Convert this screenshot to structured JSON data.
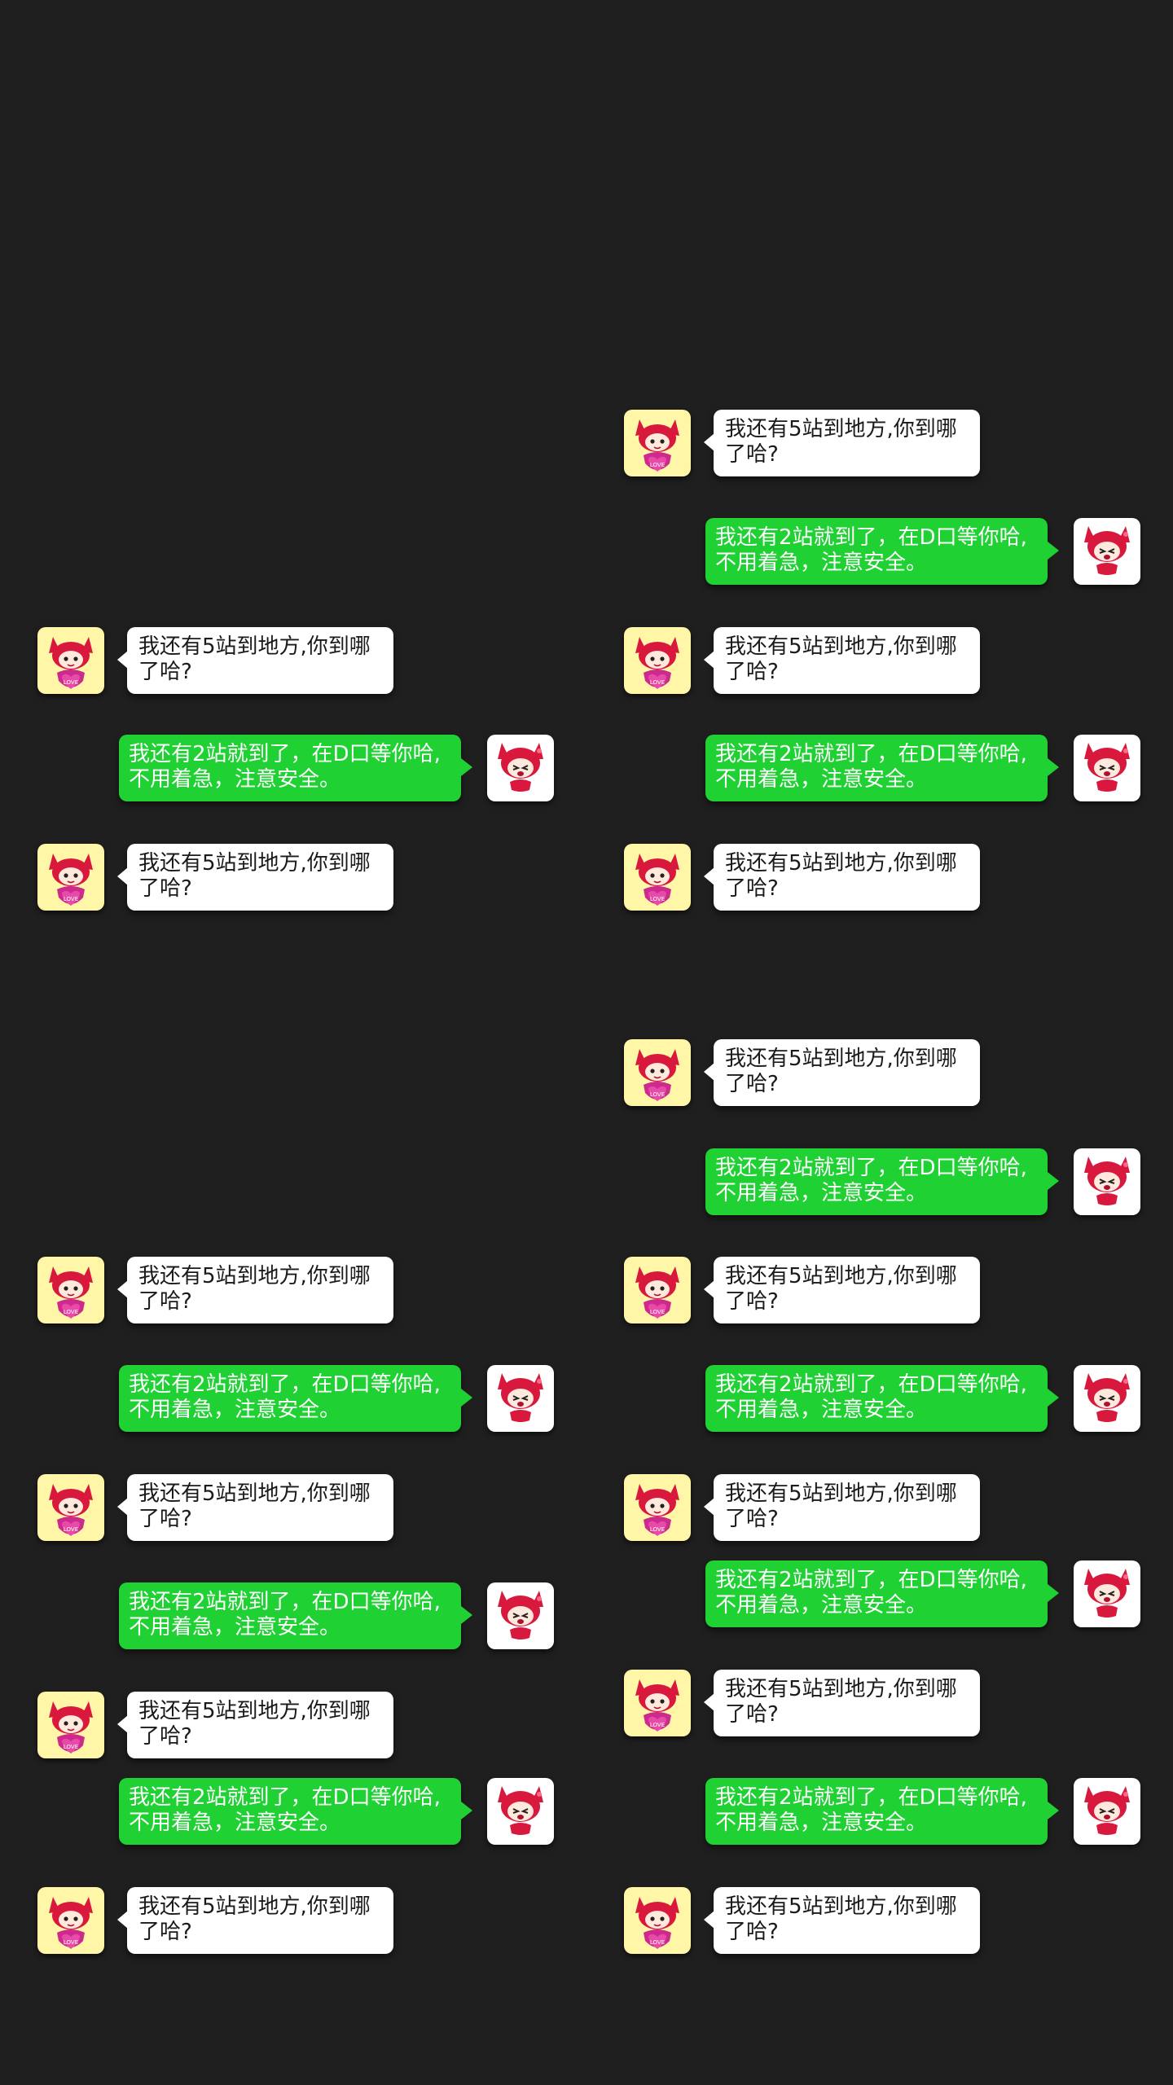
{
  "colors": {
    "background": "#1f1f1f",
    "incoming_bubble": "#ffffff",
    "outgoing_bubble": "#1fd133",
    "incoming_avatar_bg": "#fff6a8",
    "outgoing_avatar_bg": "#ffffff"
  },
  "avatars": {
    "incoming": {
      "icon": "fox-girl-love-heart-avatar-icon",
      "badge_text": "LOVE"
    },
    "outgoing": {
      "icon": "fox-girl-crying-avatar-icon",
      "caption": "给你快乐"
    }
  },
  "messages": {
    "incoming_text": "我还有5站到地方,你到哪\n了哈?",
    "outgoing_text": "我还有2站就到了，在D口等你哈,\n不用着急，注意安全。"
  },
  "conversations": {
    "left_top": [
      {
        "side": "incoming",
        "text": "我还有5站到地方,你到哪\n了哈?"
      },
      {
        "side": "outgoing",
        "text": "我还有2站就到了，在D口等你哈,\n不用着急，注意安全。"
      },
      {
        "side": "incoming",
        "text": "我还有5站到地方,你到哪\n了哈?"
      }
    ],
    "right_top": [
      {
        "side": "incoming",
        "text": "我还有5站到地方,你到哪\n了哈?"
      },
      {
        "side": "outgoing",
        "text": "我还有2站就到了，在D口等你哈,\n不用着急，注意安全。"
      },
      {
        "side": "incoming",
        "text": "我还有5站到地方,你到哪\n了哈?"
      },
      {
        "side": "outgoing",
        "text": "我还有2站就到了，在D口等你哈,\n不用着急，注意安全。"
      },
      {
        "side": "incoming",
        "text": "我还有5站到地方,你到哪\n了哈?"
      }
    ],
    "left_bottom": [
      {
        "side": "incoming",
        "text": "我还有5站到地方,你到哪\n了哈?"
      },
      {
        "side": "outgoing",
        "text": "我还有2站就到了，在D口等你哈,\n不用着急，注意安全。"
      },
      {
        "side": "incoming",
        "text": "我还有5站到地方,你到哪\n了哈?"
      },
      {
        "side": "outgoing",
        "text": "我还有2站就到了，在D口等你哈,\n不用着急，注意安全。"
      },
      {
        "side": "incoming",
        "text": "我还有5站到地方,你到哪\n了哈?"
      },
      {
        "side": "outgoing",
        "text": "我还有2站就到了，在D口等你哈,\n不用着急，注意安全。"
      },
      {
        "side": "incoming",
        "text": "我还有5站到地方,你到哪\n了哈?"
      }
    ],
    "right_bottom": [
      {
        "side": "incoming",
        "text": "我还有5站到地方,你到哪\n了哈?"
      },
      {
        "side": "outgoing",
        "text": "我还有2站就到了，在D口等你哈,\n不用着急，注意安全。"
      },
      {
        "side": "incoming",
        "text": "我还有5站到地方,你到哪\n了哈?"
      },
      {
        "side": "outgoing",
        "text": "我还有2站就到了，在D口等你哈,\n不用着急，注意安全。"
      },
      {
        "side": "incoming",
        "text": "我还有5站到地方,你到哪\n了哈?"
      },
      {
        "side": "outgoing",
        "text": "我还有2站就到了，在D口等你哈,\n不用着急，注意安全。"
      },
      {
        "side": "incoming",
        "text": "我还有5站到地方,你到哪\n了哈?"
      },
      {
        "side": "outgoing",
        "text": "我还有2站就到了，在D口等你哈,\n不用着急，注意安全。"
      },
      {
        "side": "incoming",
        "text": "我还有5站到地方,你到哪\n了哈?"
      }
    ]
  }
}
